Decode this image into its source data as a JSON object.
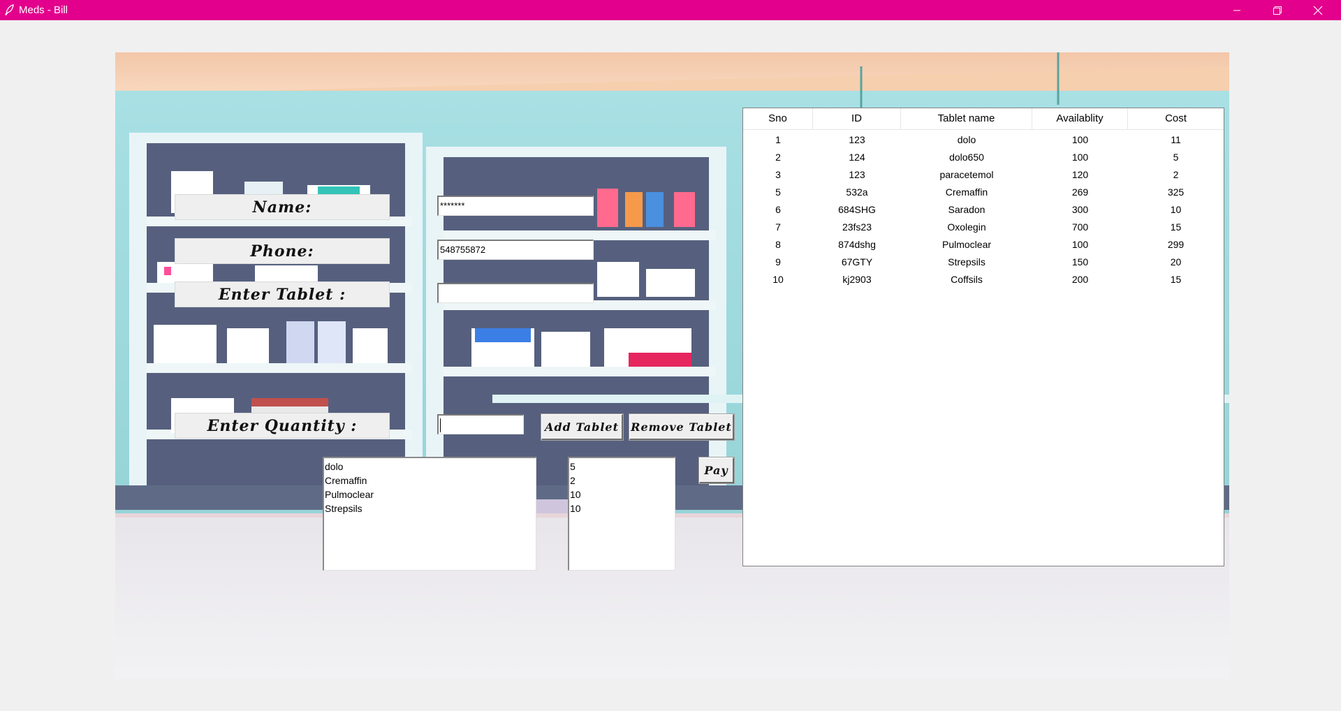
{
  "window": {
    "title": "Meds - Bill",
    "accent_color": "#e3008c",
    "controls": [
      "minimize-icon",
      "restore-icon",
      "close-icon"
    ]
  },
  "form": {
    "name_label": "Name:",
    "name_value": "*******",
    "phone_label": "Phone:",
    "phone_value": "548755872",
    "tablet_label": "Enter Tablet :",
    "tablet_value": "",
    "quantity_label": "Enter Quantity :",
    "quantity_value": ""
  },
  "buttons": {
    "add": "Add Tablet",
    "remove": "Remove Tablet",
    "pay": "Pay"
  },
  "cart": {
    "tablets": [
      "dolo",
      "Cremaffin",
      "Pulmoclear",
      "Strepsils"
    ],
    "quantities": [
      "5",
      "2",
      "10",
      "10"
    ]
  },
  "table": {
    "columns": [
      "Sno",
      "ID",
      "Tablet name",
      "Availablity",
      "Cost"
    ],
    "rows": [
      [
        "1",
        "123",
        "dolo",
        "100",
        "11"
      ],
      [
        "2",
        "124",
        "dolo650",
        "100",
        "5"
      ],
      [
        "3",
        "123",
        "paracetemol",
        "120",
        "2"
      ],
      [
        "5",
        "532a",
        "Cremaffin",
        "269",
        "325"
      ],
      [
        "6",
        "684SHG",
        "Saradon",
        "300",
        "10"
      ],
      [
        "7",
        "23fs23",
        "Oxolegin",
        "700",
        "15"
      ],
      [
        "8",
        "874dshg",
        "Pulmoclear",
        "100",
        "299"
      ],
      [
        "9",
        "67GTY",
        "Strepsils",
        "150",
        "20"
      ],
      [
        "10",
        "kj2903",
        "Coffsils",
        "200",
        "15"
      ]
    ]
  }
}
